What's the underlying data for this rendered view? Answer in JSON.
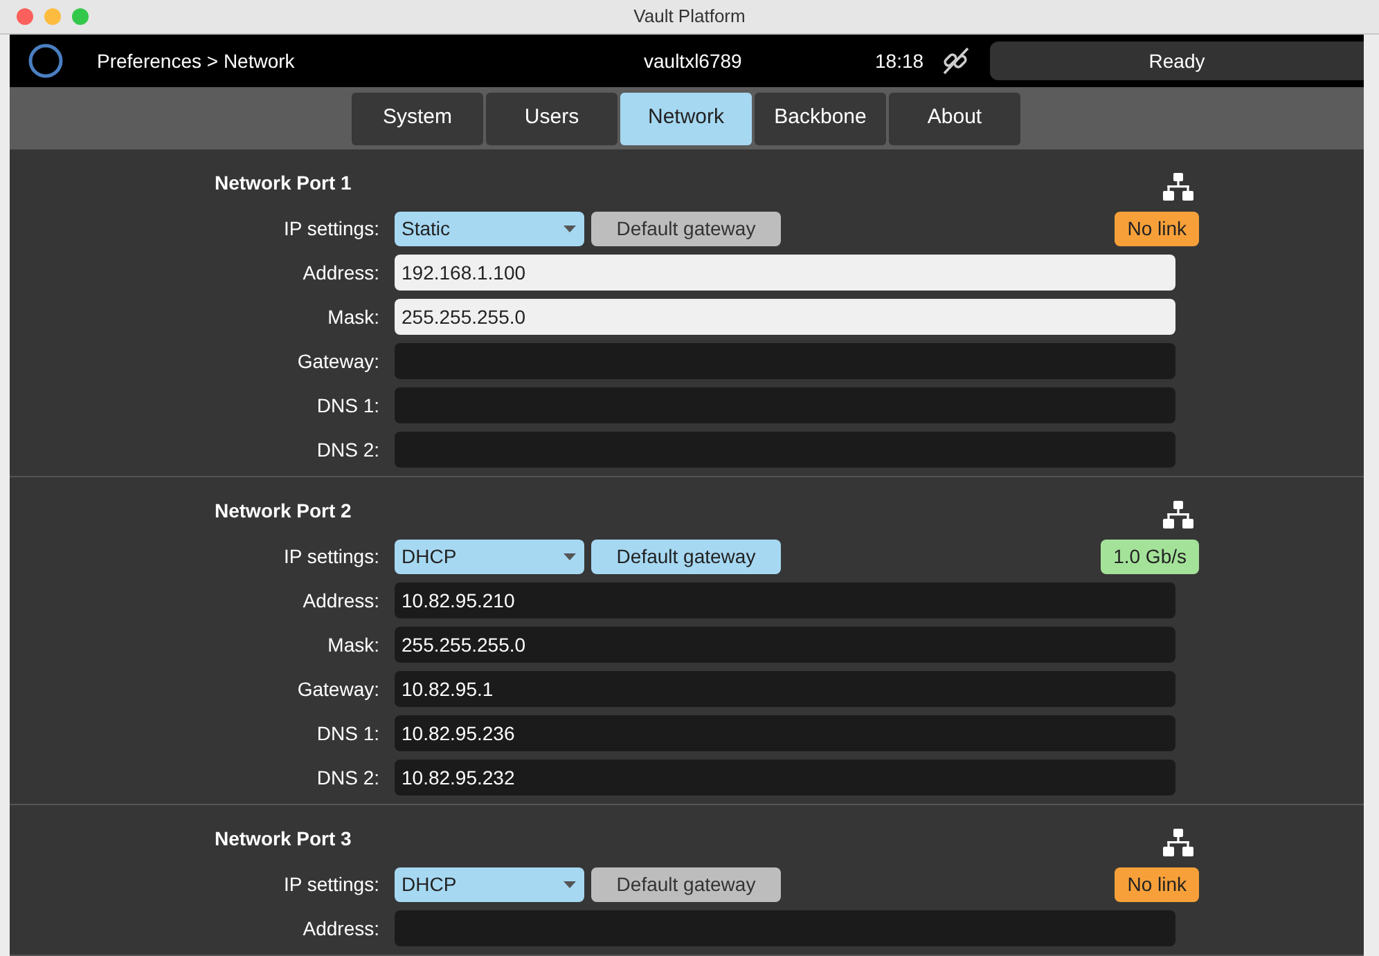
{
  "window": {
    "title": "Vault Platform"
  },
  "header": {
    "breadcrumb": "Preferences > Network",
    "hostname": "vaultxl6789",
    "time": "18:18",
    "status": "Ready"
  },
  "tabs": [
    {
      "label": "System",
      "selected": false
    },
    {
      "label": "Users",
      "selected": false
    },
    {
      "label": "Network",
      "selected": true
    },
    {
      "label": "Backbone",
      "selected": false
    },
    {
      "label": "About",
      "selected": false
    }
  ],
  "ports": [
    {
      "title": "Network Port 1",
      "ip_label": "IP settings:",
      "ip_mode": "Static",
      "gateway_button": "Default gateway",
      "gateway_enabled": false,
      "link_status": "No link",
      "linked": false,
      "fields": [
        {
          "label": "Address:",
          "value": "192.168.1.100",
          "editable": true
        },
        {
          "label": "Mask:",
          "value": "255.255.255.0",
          "editable": true
        },
        {
          "label": "Gateway:",
          "editable": false
        },
        {
          "label": "DNS 1:",
          "editable": false
        },
        {
          "label": "DNS 2:",
          "editable": false
        }
      ]
    },
    {
      "title": "Network Port 2",
      "ip_label": "IP settings:",
      "ip_mode": "DHCP",
      "gateway_button": "Default gateway",
      "gateway_enabled": true,
      "link_status": "1.0 Gb/s",
      "linked": true,
      "fields": [
        {
          "label": "Address:",
          "value": "10.82.95.210",
          "editable": false
        },
        {
          "label": "Mask:",
          "value": "255.255.255.0",
          "editable": false
        },
        {
          "label": "Gateway:",
          "value": "10.82.95.1",
          "editable": false
        },
        {
          "label": "DNS 1:",
          "value": "10.82.95.236",
          "editable": false
        },
        {
          "label": "DNS 2:",
          "value": "10.82.95.232",
          "editable": false
        }
      ]
    },
    {
      "title": "Network Port 3",
      "ip_label": "IP settings:",
      "ip_mode": "DHCP",
      "gateway_button": "Default gateway",
      "gateway_enabled": false,
      "link_status": "No link",
      "linked": false,
      "fields": [
        {
          "label": "Address:",
          "editable": false
        }
      ]
    }
  ]
}
